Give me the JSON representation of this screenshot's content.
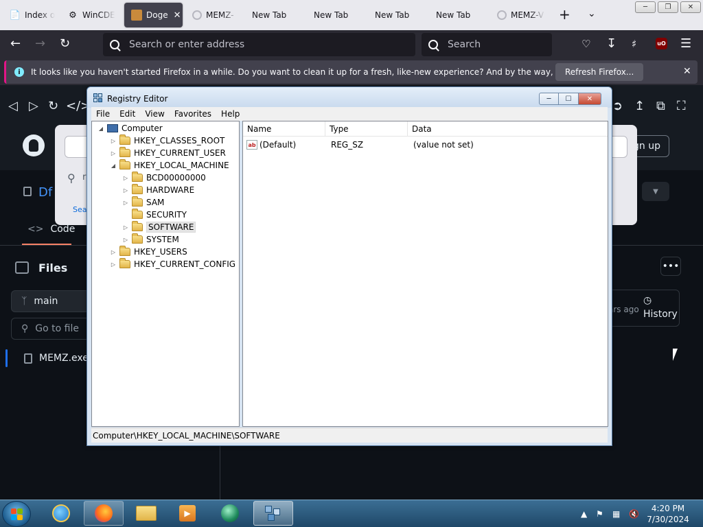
{
  "browser": {
    "tabs": [
      {
        "label": "Index of",
        "icon": "ie-page-icon"
      },
      {
        "label": "WinCDE",
        "icon": "gear-icon"
      },
      {
        "label": "Doge",
        "icon": "doge-icon",
        "active": true
      },
      {
        "label": "MEMZ-",
        "icon": "loading-icon"
      },
      {
        "label": "New Tab",
        "icon": ""
      },
      {
        "label": "New Tab",
        "icon": ""
      },
      {
        "label": "New Tab",
        "icon": ""
      },
      {
        "label": "New Tab",
        "icon": ""
      },
      {
        "label": "MEMZ-V",
        "icon": "loading-icon"
      }
    ],
    "url_placeholder": "Search or enter address",
    "search_placeholder": "Search",
    "ublock_label": "uO",
    "notification": {
      "message": "It looks like you haven't started Firefox in a while. Do you want to clean it up for a fresh, like-new experience? And by the way, welcome back!",
      "button_label": "Refresh Firefox..."
    }
  },
  "github": {
    "sign_up_label": "gn up",
    "repo_name_fragment": "Df",
    "search_field_fragment": "r",
    "search_link_fragment": "Sea",
    "code_tab_label": "Code",
    "files_title": "Files",
    "branch": "main",
    "go_to_file_placeholder": "Go to file",
    "file_item": "MEMZ.exe",
    "history_label": "History",
    "history_ago_fragment": "ars ago"
  },
  "regedit": {
    "title": "Registry Editor",
    "menu": [
      "File",
      "Edit",
      "View",
      "Favorites",
      "Help"
    ],
    "tree": {
      "root": "Computer",
      "hives": [
        "HKEY_CLASSES_ROOT",
        "HKEY_CURRENT_USER",
        "HKEY_LOCAL_MACHINE",
        "HKEY_USERS",
        "HKEY_CURRENT_CONFIG"
      ],
      "hklm_children": [
        "BCD00000000",
        "HARDWARE",
        "SAM",
        "SECURITY",
        "SOFTWARE",
        "SYSTEM"
      ],
      "selected": "SOFTWARE"
    },
    "columns": [
      "Name",
      "Type",
      "Data"
    ],
    "values": [
      {
        "name": "(Default)",
        "type": "REG_SZ",
        "data": "(value not set)"
      }
    ],
    "status_path": "Computer\\HKEY_LOCAL_MACHINE\\SOFTWARE"
  },
  "taskbar": {
    "apps": [
      "internet-explorer-icon",
      "firefox-icon",
      "file-explorer-icon",
      "media-player-icon",
      "orb-icon",
      "regedit-icon"
    ],
    "time": "4:20 PM",
    "date": "7/30/2024"
  },
  "colors": {
    "firefox_dark": "#2b2a33",
    "github_bg": "#0d1117",
    "notice_accent": "#e31587",
    "taskbar": "#1f4868"
  }
}
